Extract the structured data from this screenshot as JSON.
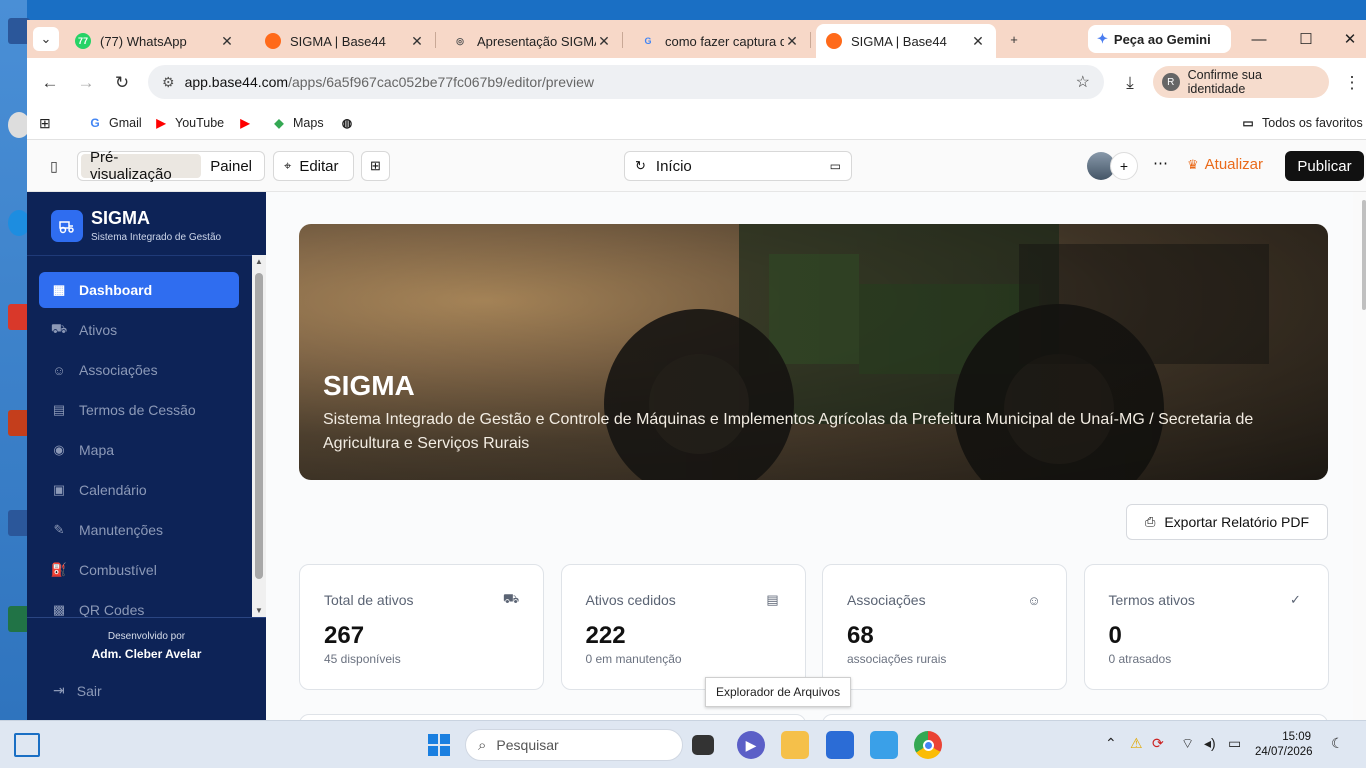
{
  "browser": {
    "tabs": [
      {
        "label": "(77) WhatsApp",
        "fav": "whatsapp-icon",
        "fav_text": "77",
        "color": "#25d366"
      },
      {
        "label": "SIGMA | Base44",
        "fav": "base44-icon",
        "fav_text": "",
        "color": "#ff6a1a"
      },
      {
        "label": "Apresentação SIGMA",
        "fav": "chatgpt-icon",
        "fav_text": "◎",
        "color": "#555555"
      },
      {
        "label": "como fazer captura de",
        "fav": "google-icon",
        "fav_text": "G",
        "color": "#4285f4"
      },
      {
        "label": "SIGMA | Base44",
        "fav": "base44-icon",
        "fav_text": "",
        "color": "#ff6a1a"
      }
    ],
    "gemini_label": "Peça ao Gemini",
    "url_host": "app.base44.com",
    "url_path": "/apps/6a5f967cac052be77fc067b9/editor/preview",
    "identity_label": "Confirme sua identidade",
    "identity_initial": "R",
    "bookmarks": [
      {
        "label": "Gmail",
        "icon": "google-icon",
        "glyph": "G",
        "color": "#4285f4"
      },
      {
        "label": "YouTube",
        "icon": "youtube-icon",
        "glyph": "▶",
        "color": "#ff0000"
      },
      {
        "label": "",
        "icon": "youtube-icon",
        "glyph": "▶",
        "color": "#ff0000"
      },
      {
        "label": "Maps",
        "icon": "maps-icon",
        "glyph": "◆",
        "color": "#34a853"
      }
    ],
    "all_bookmarks_label": "Todos os favoritos"
  },
  "editor": {
    "preview_label": "Pré-visualização",
    "panel_label": "Painel",
    "edit_label": "Editar",
    "page_select": "Início",
    "update_label": "Atualizar",
    "publish_label": "Publicar"
  },
  "app": {
    "brand_name": "SIGMA",
    "brand_sub": "Sistema Integrado de Gestão",
    "nav": [
      {
        "label": "Dashboard",
        "icon": "grid-icon",
        "glyph": "▦",
        "active": true
      },
      {
        "label": "Ativos",
        "icon": "tractor-icon",
        "glyph": "⛟",
        "active": false
      },
      {
        "label": "Associações",
        "icon": "users-icon",
        "glyph": "☺",
        "active": false
      },
      {
        "label": "Termos de Cessão",
        "icon": "document-icon",
        "glyph": "▤",
        "active": false
      },
      {
        "label": "Mapa",
        "icon": "map-pin-icon",
        "glyph": "◉",
        "active": false
      },
      {
        "label": "Calendário",
        "icon": "calendar-icon",
        "glyph": "▣",
        "active": false
      },
      {
        "label": "Manutenções",
        "icon": "wrench-icon",
        "glyph": "✎",
        "active": false
      },
      {
        "label": "Combustível",
        "icon": "fuel-icon",
        "glyph": "⛽",
        "active": false
      },
      {
        "label": "QR Codes",
        "icon": "qr-icon",
        "glyph": "▩",
        "active": false
      }
    ],
    "footer_dev": "Desenvolvido por",
    "footer_author": "Adm. Cleber Avelar",
    "logout_label": "Sair",
    "hero_title": "SIGMA",
    "hero_text": "Sistema Integrado de Gestão e Controle de Máquinas e Implementos Agrícolas da Prefeitura Municipal de Unaí-MG / Secretaria de Agricultura e Serviços Rurais",
    "export_label": "Exportar Relatório PDF",
    "cards": [
      {
        "label": "Total de ativos",
        "value": "267",
        "sub": "45 disponíveis",
        "icon": "tractor-icon",
        "glyph": "⛟"
      },
      {
        "label": "Ativos cedidos",
        "value": "222",
        "sub": "0 em manutenção",
        "icon": "document-icon",
        "glyph": "▤"
      },
      {
        "label": "Associações",
        "value": "68",
        "sub": "associações rurais",
        "icon": "users-icon",
        "glyph": "☺"
      },
      {
        "label": "Termos ativos",
        "value": "0",
        "sub": "0 atrasados",
        "icon": "check-circle-icon",
        "glyph": "✓"
      }
    ]
  },
  "tooltip": "Explorador de Arquivos",
  "taskbar": {
    "search_placeholder": "Pesquisar",
    "time": "15:09",
    "date": "24/07/2026"
  }
}
